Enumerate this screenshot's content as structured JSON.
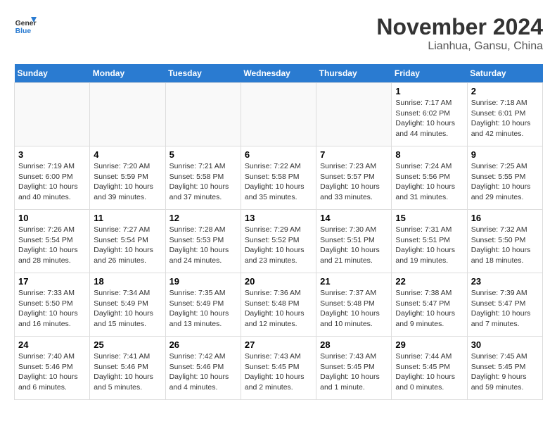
{
  "header": {
    "logo_line1": "General",
    "logo_line2": "Blue",
    "month": "November 2024",
    "location": "Lianhua, Gansu, China"
  },
  "weekdays": [
    "Sunday",
    "Monday",
    "Tuesday",
    "Wednesday",
    "Thursday",
    "Friday",
    "Saturday"
  ],
  "weeks": [
    [
      {
        "day": "",
        "info": ""
      },
      {
        "day": "",
        "info": ""
      },
      {
        "day": "",
        "info": ""
      },
      {
        "day": "",
        "info": ""
      },
      {
        "day": "",
        "info": ""
      },
      {
        "day": "1",
        "info": "Sunrise: 7:17 AM\nSunset: 6:02 PM\nDaylight: 10 hours and 44 minutes."
      },
      {
        "day": "2",
        "info": "Sunrise: 7:18 AM\nSunset: 6:01 PM\nDaylight: 10 hours and 42 minutes."
      }
    ],
    [
      {
        "day": "3",
        "info": "Sunrise: 7:19 AM\nSunset: 6:00 PM\nDaylight: 10 hours and 40 minutes."
      },
      {
        "day": "4",
        "info": "Sunrise: 7:20 AM\nSunset: 5:59 PM\nDaylight: 10 hours and 39 minutes."
      },
      {
        "day": "5",
        "info": "Sunrise: 7:21 AM\nSunset: 5:58 PM\nDaylight: 10 hours and 37 minutes."
      },
      {
        "day": "6",
        "info": "Sunrise: 7:22 AM\nSunset: 5:58 PM\nDaylight: 10 hours and 35 minutes."
      },
      {
        "day": "7",
        "info": "Sunrise: 7:23 AM\nSunset: 5:57 PM\nDaylight: 10 hours and 33 minutes."
      },
      {
        "day": "8",
        "info": "Sunrise: 7:24 AM\nSunset: 5:56 PM\nDaylight: 10 hours and 31 minutes."
      },
      {
        "day": "9",
        "info": "Sunrise: 7:25 AM\nSunset: 5:55 PM\nDaylight: 10 hours and 29 minutes."
      }
    ],
    [
      {
        "day": "10",
        "info": "Sunrise: 7:26 AM\nSunset: 5:54 PM\nDaylight: 10 hours and 28 minutes."
      },
      {
        "day": "11",
        "info": "Sunrise: 7:27 AM\nSunset: 5:54 PM\nDaylight: 10 hours and 26 minutes."
      },
      {
        "day": "12",
        "info": "Sunrise: 7:28 AM\nSunset: 5:53 PM\nDaylight: 10 hours and 24 minutes."
      },
      {
        "day": "13",
        "info": "Sunrise: 7:29 AM\nSunset: 5:52 PM\nDaylight: 10 hours and 23 minutes."
      },
      {
        "day": "14",
        "info": "Sunrise: 7:30 AM\nSunset: 5:51 PM\nDaylight: 10 hours and 21 minutes."
      },
      {
        "day": "15",
        "info": "Sunrise: 7:31 AM\nSunset: 5:51 PM\nDaylight: 10 hours and 19 minutes."
      },
      {
        "day": "16",
        "info": "Sunrise: 7:32 AM\nSunset: 5:50 PM\nDaylight: 10 hours and 18 minutes."
      }
    ],
    [
      {
        "day": "17",
        "info": "Sunrise: 7:33 AM\nSunset: 5:50 PM\nDaylight: 10 hours and 16 minutes."
      },
      {
        "day": "18",
        "info": "Sunrise: 7:34 AM\nSunset: 5:49 PM\nDaylight: 10 hours and 15 minutes."
      },
      {
        "day": "19",
        "info": "Sunrise: 7:35 AM\nSunset: 5:49 PM\nDaylight: 10 hours and 13 minutes."
      },
      {
        "day": "20",
        "info": "Sunrise: 7:36 AM\nSunset: 5:48 PM\nDaylight: 10 hours and 12 minutes."
      },
      {
        "day": "21",
        "info": "Sunrise: 7:37 AM\nSunset: 5:48 PM\nDaylight: 10 hours and 10 minutes."
      },
      {
        "day": "22",
        "info": "Sunrise: 7:38 AM\nSunset: 5:47 PM\nDaylight: 10 hours and 9 minutes."
      },
      {
        "day": "23",
        "info": "Sunrise: 7:39 AM\nSunset: 5:47 PM\nDaylight: 10 hours and 7 minutes."
      }
    ],
    [
      {
        "day": "24",
        "info": "Sunrise: 7:40 AM\nSunset: 5:46 PM\nDaylight: 10 hours and 6 minutes."
      },
      {
        "day": "25",
        "info": "Sunrise: 7:41 AM\nSunset: 5:46 PM\nDaylight: 10 hours and 5 minutes."
      },
      {
        "day": "26",
        "info": "Sunrise: 7:42 AM\nSunset: 5:46 PM\nDaylight: 10 hours and 4 minutes."
      },
      {
        "day": "27",
        "info": "Sunrise: 7:43 AM\nSunset: 5:45 PM\nDaylight: 10 hours and 2 minutes."
      },
      {
        "day": "28",
        "info": "Sunrise: 7:43 AM\nSunset: 5:45 PM\nDaylight: 10 hours and 1 minute."
      },
      {
        "day": "29",
        "info": "Sunrise: 7:44 AM\nSunset: 5:45 PM\nDaylight: 10 hours and 0 minutes."
      },
      {
        "day": "30",
        "info": "Sunrise: 7:45 AM\nSunset: 5:45 PM\nDaylight: 9 hours and 59 minutes."
      }
    ]
  ]
}
